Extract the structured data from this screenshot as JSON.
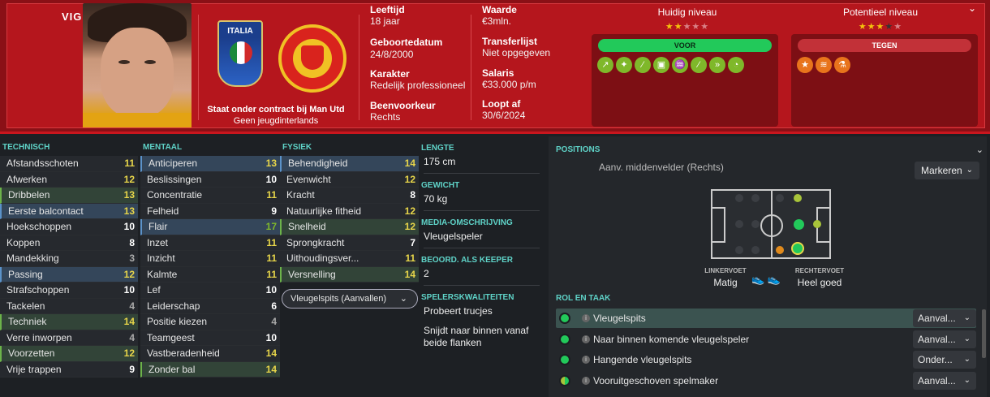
{
  "header": {
    "name": "VIGNAI",
    "nation": "ITALIA",
    "contract_line1": "Staat onder contract bij Man Utd",
    "contract_line2": "Geen jeugdinterlands",
    "age_label": "Leeftijd",
    "age": "18 jaar",
    "dob_label": "Geboortedatum",
    "dob": "24/8/2000",
    "character_label": "Karakter",
    "character": "Redelijk professioneel",
    "foot_label": "Beenvoorkeur",
    "foot": "Rechts",
    "value_label": "Waarde",
    "value": "€3mln.",
    "transfer_label": "Transferlijst",
    "transfer": "Niet opgegeven",
    "salary_label": "Salaris",
    "salary": "€33.000 p/m",
    "expires_label": "Loopt af",
    "expires": "30/6/2024",
    "current_level_label": "Huidig niveau",
    "current_level_stars": 2,
    "potential_level_label": "Potentieel niveau",
    "potential_level_stars": 3,
    "pros_label": "VOOR",
    "cons_label": "TEGEN"
  },
  "technical": {
    "title": "TECHNISCH",
    "rows": [
      {
        "label": "Afstandsschoten",
        "value": "11"
      },
      {
        "label": "Afwerken",
        "value": "12"
      },
      {
        "label": "Dribbelen",
        "value": "13"
      },
      {
        "label": "Eerste balcontact",
        "value": "13"
      },
      {
        "label": "Hoekschoppen",
        "value": "10"
      },
      {
        "label": "Koppen",
        "value": "8"
      },
      {
        "label": "Mandekking",
        "value": "3"
      },
      {
        "label": "Passing",
        "value": "12"
      },
      {
        "label": "Strafschoppen",
        "value": "10"
      },
      {
        "label": "Tackelen",
        "value": "4"
      },
      {
        "label": "Techniek",
        "value": "14"
      },
      {
        "label": "Verre inworpen",
        "value": "4"
      },
      {
        "label": "Voorzetten",
        "value": "12"
      },
      {
        "label": "Vrije trappen",
        "value": "9"
      }
    ]
  },
  "mental": {
    "title": "MENTAAL",
    "rows": [
      {
        "label": "Anticiperen",
        "value": "13"
      },
      {
        "label": "Beslissingen",
        "value": "10"
      },
      {
        "label": "Concentratie",
        "value": "11"
      },
      {
        "label": "Felheid",
        "value": "9"
      },
      {
        "label": "Flair",
        "value": "17"
      },
      {
        "label": "Inzet",
        "value": "11"
      },
      {
        "label": "Inzicht",
        "value": "11"
      },
      {
        "label": "Kalmte",
        "value": "11"
      },
      {
        "label": "Lef",
        "value": "10"
      },
      {
        "label": "Leiderschap",
        "value": "6"
      },
      {
        "label": "Positie kiezen",
        "value": "4"
      },
      {
        "label": "Teamgeest",
        "value": "10"
      },
      {
        "label": "Vastberadenheid",
        "value": "14"
      },
      {
        "label": "Zonder bal",
        "value": "14"
      }
    ]
  },
  "physical": {
    "title": "FYSIEK",
    "rows": [
      {
        "label": "Behendigheid",
        "value": "14"
      },
      {
        "label": "Evenwicht",
        "value": "12"
      },
      {
        "label": "Kracht",
        "value": "8"
      },
      {
        "label": "Natuurlijke fitheid",
        "value": "12"
      },
      {
        "label": "Snelheid",
        "value": "12"
      },
      {
        "label": "Sprongkracht",
        "value": "7"
      },
      {
        "label": "Uithoudingsver...",
        "value": "11"
      },
      {
        "label": "Versnelling",
        "value": "14"
      }
    ],
    "role_select": "Vleugelspits (Aanvallen)"
  },
  "facts": {
    "height_label": "LENGTE",
    "height": "175 cm",
    "weight_label": "GEWICHT",
    "weight": "70 kg",
    "media_label": "MEDIA-OMSCHRIJVING",
    "media": "Vleugelspeler",
    "keeper_label": "BEOORD. ALS KEEPER",
    "keeper": "2",
    "traits_label": "SPELERSKWALITEITEN",
    "traits": [
      "Probeert trucjes",
      "Snijdt naar binnen vanaf beide flanken"
    ]
  },
  "positions": {
    "title": "POSITIONS",
    "current": "Aanv. middenvelder (Rechts)",
    "mark_button": "Markeren",
    "left_foot_label": "LINKERVOET",
    "left_foot": "Matig",
    "right_foot_label": "RECHTERVOET",
    "right_foot": "Heel goed"
  },
  "roles": {
    "title": "ROL EN TAAK",
    "items": [
      {
        "label": "Vleugelspits",
        "duty": "Aanval..."
      },
      {
        "label": "Naar binnen komende vleugelspeler",
        "duty": "Aanval..."
      },
      {
        "label": "Hangende vleugelspits",
        "duty": "Onder..."
      },
      {
        "label": "Vooruitgeschoven spelmaker",
        "duty": "Aanval..."
      }
    ]
  },
  "colors": {
    "accent": "#5fd3c8",
    "header_red": "#b5161d",
    "good": "#22c95a",
    "bad": "#c23138"
  }
}
